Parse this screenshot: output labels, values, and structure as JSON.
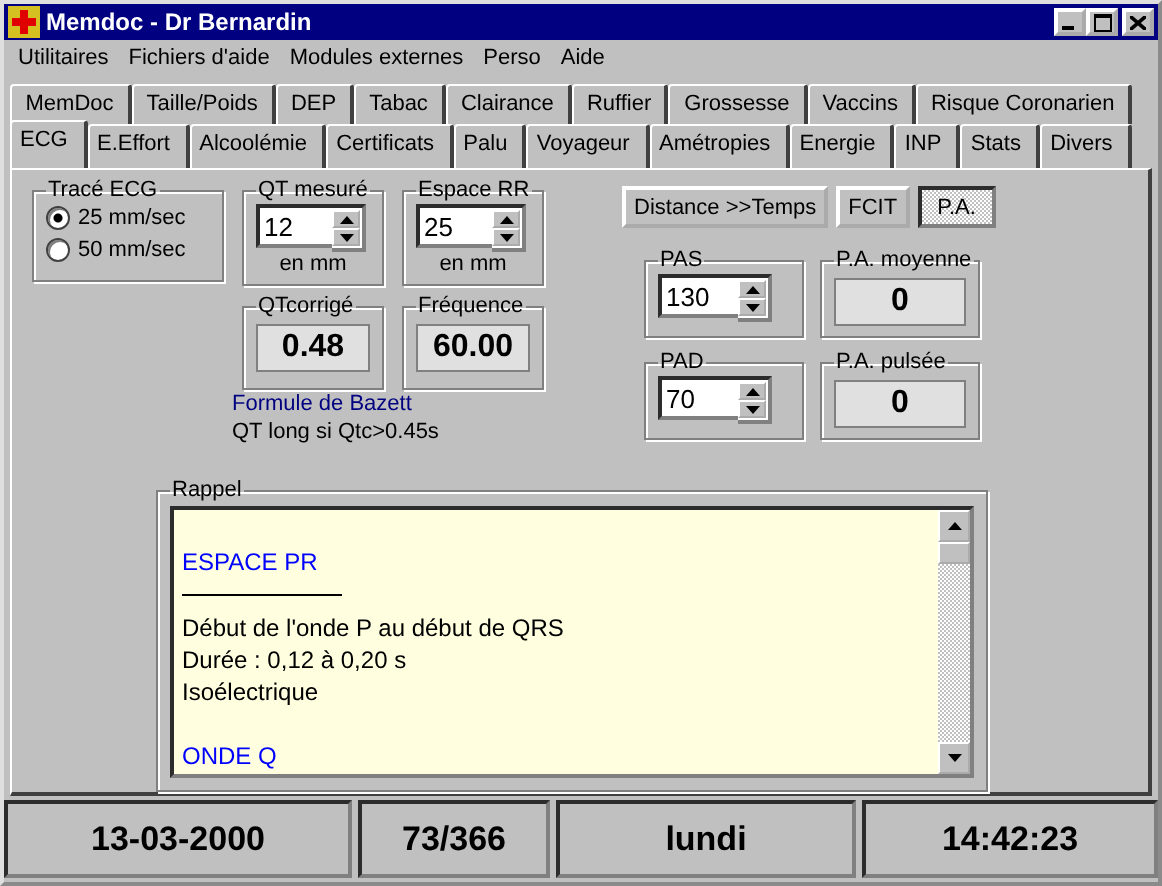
{
  "window": {
    "title": "Memdoc - Dr Bernardin"
  },
  "menu": [
    "Utilitaires",
    "Fichiers d'aide",
    "Modules externes",
    "Perso",
    "Aide"
  ],
  "tab_rows": [
    [
      {
        "label": "MemDoc",
        "selected": false
      },
      {
        "label": "Taille/Poids",
        "selected": false
      },
      {
        "label": "DEP",
        "selected": false
      },
      {
        "label": "Tabac",
        "selected": false
      },
      {
        "label": "Clairance",
        "selected": false
      },
      {
        "label": "Ruffier",
        "selected": false
      },
      {
        "label": "Grossesse",
        "selected": false
      },
      {
        "label": "Vaccins",
        "selected": false
      },
      {
        "label": "Risque Coronarien",
        "selected": false
      }
    ],
    [
      {
        "label": "ECG",
        "selected": true
      },
      {
        "label": "E.Effort",
        "selected": false
      },
      {
        "label": "Alcoolémie",
        "selected": false
      },
      {
        "label": "Certificats",
        "selected": false
      },
      {
        "label": "Palu",
        "selected": false
      },
      {
        "label": "Voyageur",
        "selected": false
      },
      {
        "label": "Amétropies",
        "selected": false
      },
      {
        "label": "Energie",
        "selected": false
      },
      {
        "label": "INP",
        "selected": false
      },
      {
        "label": "Stats",
        "selected": false
      },
      {
        "label": "Divers",
        "selected": false
      }
    ]
  ],
  "ecg_trace": {
    "title": "Tracé ECG",
    "options": [
      {
        "label": "25 mm/sec",
        "selected": true
      },
      {
        "label": "50 mm/sec",
        "selected": false
      }
    ]
  },
  "qt_inputs": [
    {
      "title": "QT mesuré",
      "value": "12",
      "unit": "en mm"
    },
    {
      "title": "Espace RR",
      "value": "25",
      "unit": "en mm"
    }
  ],
  "qt_outputs": [
    {
      "title": "QTcorrigé",
      "value": "0.48"
    },
    {
      "title": "Fréquence",
      "value": "60.00"
    }
  ],
  "formula_link": "Formule de Bazett",
  "note": "QT long si Qtc>0.45s",
  "mode_buttons": [
    {
      "label": "Distance >>Temps",
      "selected": false
    },
    {
      "label": "FCIT",
      "selected": false
    },
    {
      "label": "P.A.",
      "selected": true
    }
  ],
  "pressure_rows": [
    {
      "input": {
        "title": "PAS",
        "value": "130"
      },
      "output": {
        "title": "P.A. moyenne",
        "value": "0"
      }
    },
    {
      "input": {
        "title": "PAD",
        "value": "70"
      },
      "output": {
        "title": "P.A. pulsée",
        "value": "0"
      }
    }
  ],
  "rappel": {
    "title": "Rappel",
    "lines": [
      {
        "kind": "blank"
      },
      {
        "kind": "heading",
        "text": "ESPACE PR"
      },
      {
        "kind": "rule"
      },
      {
        "kind": "text",
        "text": "Début de l'onde P au début de QRS"
      },
      {
        "kind": "text",
        "text": "Durée : 0,12 à 0,20 s"
      },
      {
        "kind": "text",
        "text": "Isoélectrique"
      },
      {
        "kind": "blank"
      },
      {
        "kind": "heading",
        "text": "ONDE Q"
      }
    ]
  },
  "status_bar": [
    "13-03-2000",
    "73/366",
    "lundi",
    "14:42:23"
  ]
}
